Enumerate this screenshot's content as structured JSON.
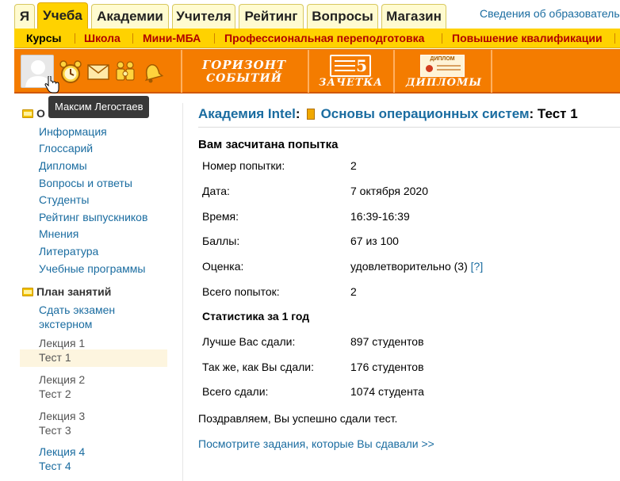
{
  "tabs": [
    {
      "label": "Я",
      "active": false
    },
    {
      "label": "Учеба",
      "active": true
    },
    {
      "label": "Академии",
      "active": false
    },
    {
      "label": "Учителя",
      "active": false
    },
    {
      "label": "Рейтинг",
      "active": false
    },
    {
      "label": "Вопросы",
      "active": false
    },
    {
      "label": "Магазин",
      "active": false
    }
  ],
  "edu_info_link": "Сведения об образовательной",
  "submenu": [
    "Курсы",
    "Школа",
    "Мини-МБА",
    "Профессиональная переподготовка",
    "Повышение квалификации"
  ],
  "banner": {
    "icons": [
      "alarm-clock-icon",
      "envelope-icon",
      "family-icon",
      "bell-icon"
    ],
    "horizon": {
      "line1": "ГОРИЗОНТ",
      "line2": "СОБЫТИЙ"
    },
    "zachetka": {
      "badge": "5",
      "label": "ЗАЧЕТКА"
    },
    "diplomas": {
      "badge": "ДИПЛОМ",
      "label": "ДИПЛОМЫ"
    }
  },
  "tooltip": "Максим Легостаев",
  "sidebar": {
    "section1_title": "О",
    "links": [
      "Информация",
      "Глоссарий",
      "Дипломы",
      "Вопросы и ответы",
      "Студенты",
      "Рейтинг выпускников",
      "Мнения",
      "Литература",
      "Учебные программы"
    ],
    "section2_title": "План занятий",
    "exam_link": [
      "Сдать экзамен",
      "экстерном"
    ],
    "lessons": [
      {
        "lecture": "Лекция 1",
        "test": "Тест 1",
        "current": true
      },
      {
        "lecture": "Лекция 2",
        "test": "Тест 2",
        "current": false
      },
      {
        "lecture": "Лекция 3",
        "test": "Тест 3",
        "current": false
      },
      {
        "lecture": "Лекция 4",
        "test": "Тест 4",
        "current": false
      }
    ]
  },
  "main": {
    "crumb_academy": "Академия Intel",
    "crumb_sep": ":",
    "crumb_course": "Основы операционных систем",
    "crumb_page": ": Тест 1",
    "result_title": "Вам засчитана попытка",
    "rows": [
      {
        "key": "Номер попытки:",
        "value": "2"
      },
      {
        "key": "Дата:",
        "value": "7 октября 2020"
      },
      {
        "key": "Время:",
        "value": "16:39-16:39"
      },
      {
        "key": "Баллы:",
        "value": "67 из 100"
      },
      {
        "key": "Оценка:",
        "value": "удовлетворительно (3)",
        "help": "[?]"
      },
      {
        "key": "Всего попыток:",
        "value": "2"
      }
    ],
    "stats_title": "Статистика за 1 год",
    "stats": [
      {
        "key": "Лучше Вас сдали:",
        "value": "897 студентов"
      },
      {
        "key": "Так же, как Вы сдали:",
        "value": "176 студентов"
      },
      {
        "key": "Всего сдали:",
        "value": "1074 студента"
      }
    ],
    "congrats": "Поздравляем, Вы успешно сдали тест.",
    "view_tasks_link": "Посмотрите задания, которые Вы сдавали >>"
  },
  "colors": {
    "accent": "#ffd200",
    "banner": "#f47c00",
    "link": "#1a6ca0",
    "submenu_text": "#b00000"
  }
}
